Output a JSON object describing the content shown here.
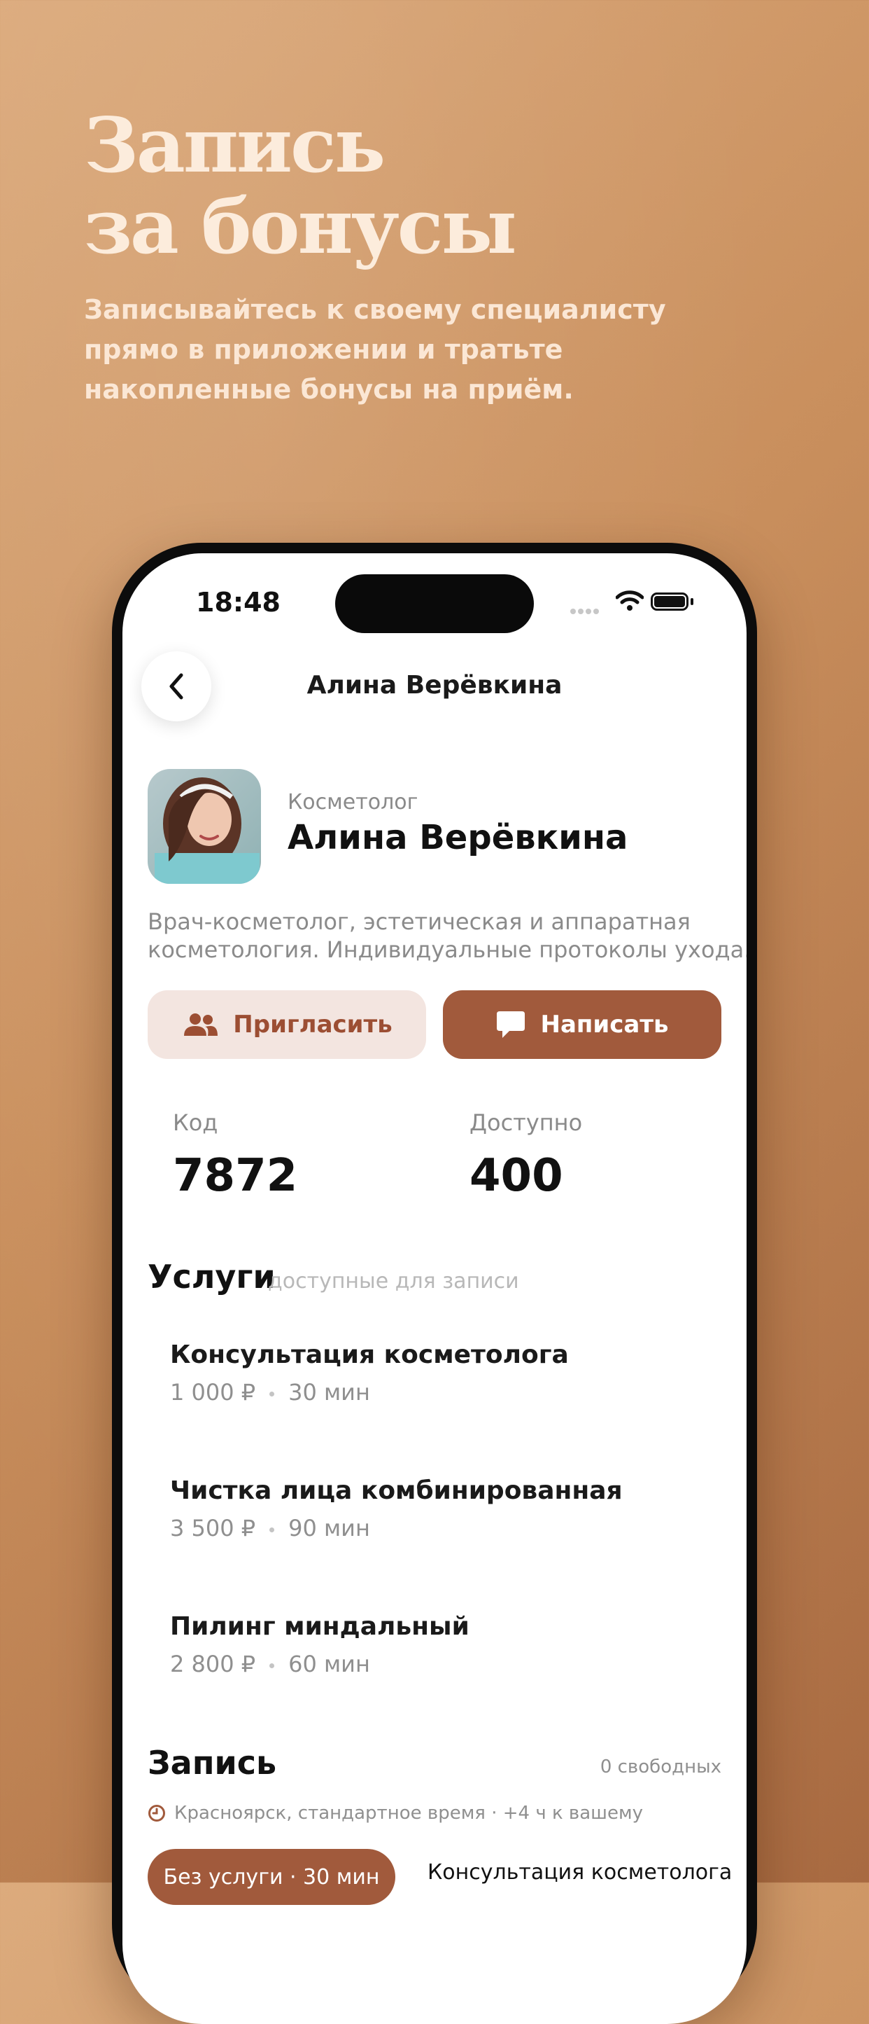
{
  "promo": {
    "title_line1": "Запись",
    "title_line2": "за бонусы",
    "subtitle_lines": [
      "Записывайтесь к своему специалисту",
      "прямо в приложении и тратьте",
      "накопленные бонусы на приём."
    ]
  },
  "status_bar": {
    "time": "18:48"
  },
  "nav": {
    "title": "Алина Верёвкина",
    "back_icon": "chevron-left-icon"
  },
  "profile": {
    "role": "Косметолог",
    "name": "Алина Верёвкина",
    "bio_lines": [
      "Врач-косметолог, эстетическая и аппаратная",
      "косметология. Индивидуальные протоколы ухода."
    ]
  },
  "actions": {
    "invite_label": "Пригласить",
    "invite_icon": "people-icon",
    "write_label": "Написать",
    "write_icon": "chat-bubble-icon"
  },
  "stats": {
    "code_label": "Код",
    "code_value": "7872",
    "available_label": "Доступно",
    "available_value": "400"
  },
  "services": {
    "title": "Услуги",
    "hint": "доступные для записи",
    "items": [
      {
        "name": "Консультация косметолога",
        "price": "1 000 ₽",
        "duration": "30 мин"
      },
      {
        "name": "Чистка лица комбинированная",
        "price": "3 500 ₽",
        "duration": "90 мин"
      },
      {
        "name": "Пилинг миндальный",
        "price": "2 800 ₽",
        "duration": "60 мин"
      }
    ]
  },
  "booking": {
    "title": "Запись",
    "free_slots": "0 свободных",
    "timezone": "Красноярск, стандартное время · +4 ч к вашему",
    "chips": [
      "Без услуги · 30 мин",
      "Консультация косметолога"
    ]
  },
  "colors": {
    "accent": "#a15a3c",
    "accent_soft": "#f3e5e0",
    "headline": "#fcecdc",
    "background_top": "#dcab7d",
    "background_bottom": "#a86a41"
  }
}
